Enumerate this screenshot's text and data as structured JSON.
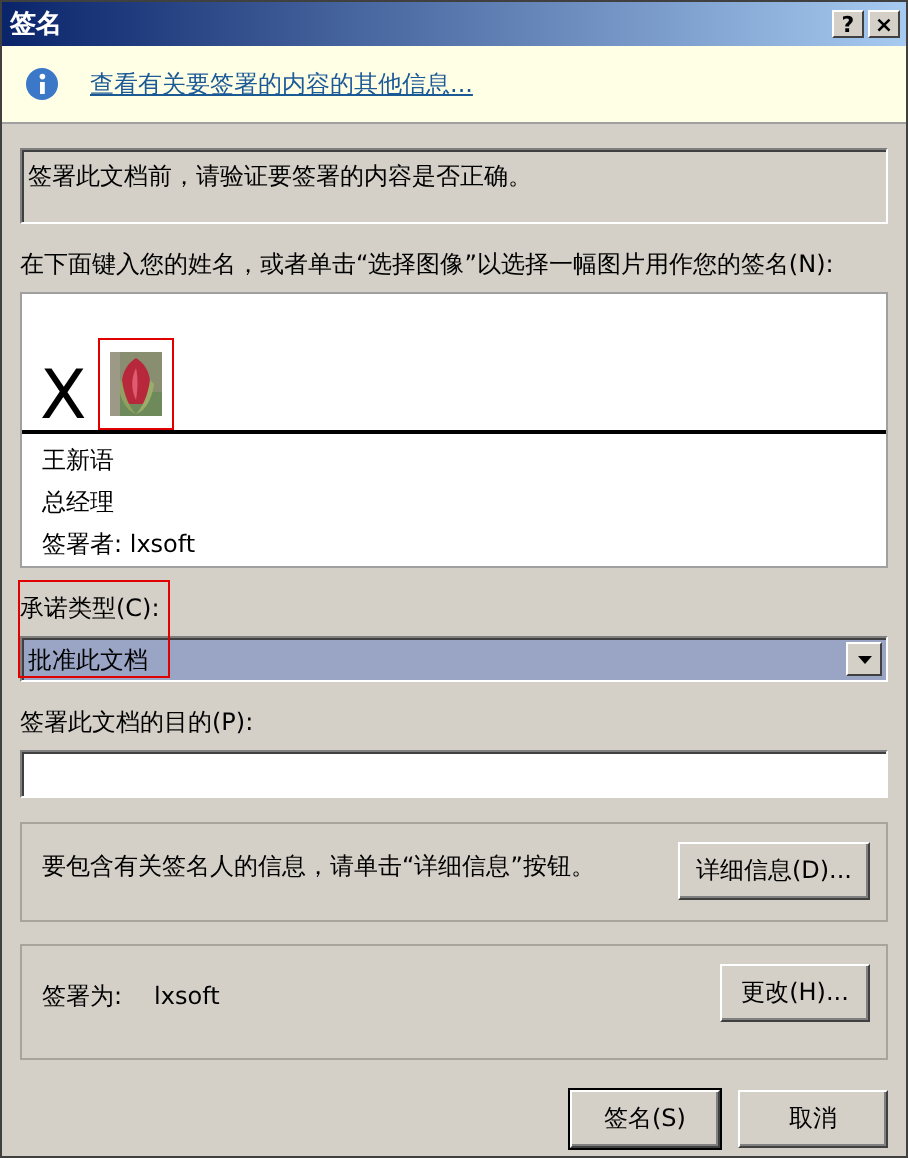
{
  "window": {
    "title": "签名",
    "title_buttons": [
      "?",
      "×"
    ]
  },
  "info_bar": {
    "link": "查看有关要签署的内容的其他信息..."
  },
  "notice": "签署此文档前，请验证要签署的内容是否正确。",
  "signature": {
    "label": "在下面键入您的姓名，或者单击“选择图像”以选择一幅图片用作您的签名(N):",
    "mark": "X",
    "lines": [
      "王新语",
      "总经理",
      "签署者: lxsoft"
    ]
  },
  "commitment": {
    "label": "承诺类型(C):",
    "value": "批准此文档"
  },
  "purpose": {
    "label": "签署此文档的目的(P):"
  },
  "details": {
    "text": "要包含有关签名人的信息，请单击“详细信息”按钮。",
    "button": "详细信息(D)..."
  },
  "signer": {
    "label": "签署为:",
    "value": "lxsoft",
    "button": "更改(H)..."
  },
  "buttons": [
    {
      "label": "签名(S)",
      "default": true
    },
    {
      "label": "取消",
      "default": false
    }
  ]
}
